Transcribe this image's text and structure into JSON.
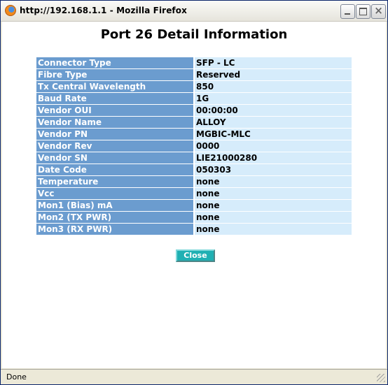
{
  "window": {
    "title": "http://192.168.1.1 - Mozilla Firefox"
  },
  "page": {
    "title": "Port 26 Detail Information",
    "close_label": "Close"
  },
  "rows": [
    {
      "label": "Connector Type",
      "value": "SFP - LC"
    },
    {
      "label": "Fibre Type",
      "value": "Reserved"
    },
    {
      "label": "Tx Central Wavelength",
      "value": "850"
    },
    {
      "label": "Baud Rate",
      "value": "1G"
    },
    {
      "label": "Vendor OUI",
      "value": "00:00:00"
    },
    {
      "label": "Vendor Name",
      "value": "ALLOY"
    },
    {
      "label": "Vendor PN",
      "value": "MGBIC-MLC"
    },
    {
      "label": "Vendor Rev",
      "value": "0000"
    },
    {
      "label": "Vendor SN",
      "value": "LIE21000280"
    },
    {
      "label": "Date Code",
      "value": "050303"
    },
    {
      "label": "Temperature",
      "value": "none"
    },
    {
      "label": "Vcc",
      "value": "none"
    },
    {
      "label": "Mon1 (Bias) mA",
      "value": "none"
    },
    {
      "label": "Mon2 (TX PWR)",
      "value": "none"
    },
    {
      "label": "Mon3 (RX PWR)",
      "value": "none"
    }
  ],
  "status": {
    "text": "Done"
  }
}
